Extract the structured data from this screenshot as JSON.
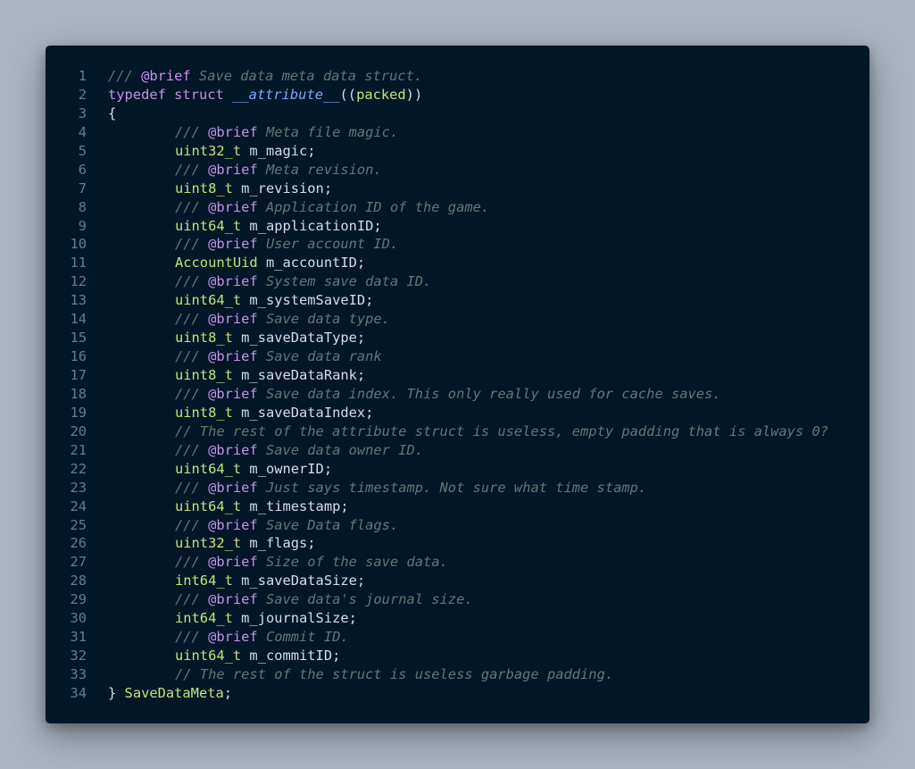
{
  "editor": {
    "colors": {
      "background": "#011627",
      "page_background": "#a8b4bf",
      "line_number": "#5f7e97",
      "comment": "#637777",
      "keyword": "#c792ea",
      "attribute": "#82aaff",
      "type": "#c5e478",
      "text": "#d6deeb"
    },
    "lines": [
      {
        "n": "1",
        "indent": 0,
        "tokens": [
          {
            "c": "comment",
            "t": "/// "
          },
          {
            "c": "tag",
            "t": "@brief"
          },
          {
            "c": "comment",
            "t": " Save data meta data struct."
          }
        ]
      },
      {
        "n": "2",
        "indent": 0,
        "tokens": [
          {
            "c": "keyword",
            "t": "typedef"
          },
          {
            "c": "text",
            "t": " "
          },
          {
            "c": "keyword",
            "t": "struct"
          },
          {
            "c": "text",
            "t": " "
          },
          {
            "c": "attr",
            "t": "__attribute__"
          },
          {
            "c": "punct",
            "t": "(("
          },
          {
            "c": "type",
            "t": "packed"
          },
          {
            "c": "punct",
            "t": "))"
          }
        ]
      },
      {
        "n": "3",
        "indent": 0,
        "tokens": [
          {
            "c": "punct",
            "t": "{"
          }
        ]
      },
      {
        "n": "4",
        "indent": 1,
        "tokens": [
          {
            "c": "comment",
            "t": "/// "
          },
          {
            "c": "tag",
            "t": "@brief"
          },
          {
            "c": "comment",
            "t": " Meta file magic."
          }
        ]
      },
      {
        "n": "5",
        "indent": 1,
        "tokens": [
          {
            "c": "type",
            "t": "uint32_t"
          },
          {
            "c": "text",
            "t": " "
          },
          {
            "c": "ident",
            "t": "m_magic"
          },
          {
            "c": "punct",
            "t": ";"
          }
        ]
      },
      {
        "n": "6",
        "indent": 1,
        "tokens": [
          {
            "c": "comment",
            "t": "/// "
          },
          {
            "c": "tag",
            "t": "@brief"
          },
          {
            "c": "comment",
            "t": " Meta revision."
          }
        ]
      },
      {
        "n": "7",
        "indent": 1,
        "tokens": [
          {
            "c": "type",
            "t": "uint8_t"
          },
          {
            "c": "text",
            "t": " "
          },
          {
            "c": "ident",
            "t": "m_revision"
          },
          {
            "c": "punct",
            "t": ";"
          }
        ]
      },
      {
        "n": "8",
        "indent": 1,
        "tokens": [
          {
            "c": "comment",
            "t": "/// "
          },
          {
            "c": "tag",
            "t": "@brief"
          },
          {
            "c": "comment",
            "t": " Application ID of the game."
          }
        ]
      },
      {
        "n": "9",
        "indent": 1,
        "tokens": [
          {
            "c": "type",
            "t": "uint64_t"
          },
          {
            "c": "text",
            "t": " "
          },
          {
            "c": "ident",
            "t": "m_applicationID"
          },
          {
            "c": "punct",
            "t": ";"
          }
        ]
      },
      {
        "n": "10",
        "indent": 1,
        "tokens": [
          {
            "c": "comment",
            "t": "/// "
          },
          {
            "c": "tag",
            "t": "@brief"
          },
          {
            "c": "comment",
            "t": " User account ID."
          }
        ]
      },
      {
        "n": "11",
        "indent": 1,
        "tokens": [
          {
            "c": "type",
            "t": "AccountUid"
          },
          {
            "c": "text",
            "t": " "
          },
          {
            "c": "ident",
            "t": "m_accountID"
          },
          {
            "c": "punct",
            "t": ";"
          }
        ]
      },
      {
        "n": "12",
        "indent": 1,
        "tokens": [
          {
            "c": "comment",
            "t": "/// "
          },
          {
            "c": "tag",
            "t": "@brief"
          },
          {
            "c": "comment",
            "t": " System save data ID."
          }
        ]
      },
      {
        "n": "13",
        "indent": 1,
        "tokens": [
          {
            "c": "type",
            "t": "uint64_t"
          },
          {
            "c": "text",
            "t": " "
          },
          {
            "c": "ident",
            "t": "m_systemSaveID"
          },
          {
            "c": "punct",
            "t": ";"
          }
        ]
      },
      {
        "n": "14",
        "indent": 1,
        "tokens": [
          {
            "c": "comment",
            "t": "/// "
          },
          {
            "c": "tag",
            "t": "@brief"
          },
          {
            "c": "comment",
            "t": " Save data type."
          }
        ]
      },
      {
        "n": "15",
        "indent": 1,
        "tokens": [
          {
            "c": "type",
            "t": "uint8_t"
          },
          {
            "c": "text",
            "t": " "
          },
          {
            "c": "ident",
            "t": "m_saveDataType"
          },
          {
            "c": "punct",
            "t": ";"
          }
        ]
      },
      {
        "n": "16",
        "indent": 1,
        "tokens": [
          {
            "c": "comment",
            "t": "/// "
          },
          {
            "c": "tag",
            "t": "@brief"
          },
          {
            "c": "comment",
            "t": " Save data rank"
          }
        ]
      },
      {
        "n": "17",
        "indent": 1,
        "tokens": [
          {
            "c": "type",
            "t": "uint8_t"
          },
          {
            "c": "text",
            "t": " "
          },
          {
            "c": "ident",
            "t": "m_saveDataRank"
          },
          {
            "c": "punct",
            "t": ";"
          }
        ]
      },
      {
        "n": "18",
        "indent": 1,
        "tokens": [
          {
            "c": "comment",
            "t": "/// "
          },
          {
            "c": "tag",
            "t": "@brief"
          },
          {
            "c": "comment",
            "t": " Save data index. This only really used for cache saves."
          }
        ]
      },
      {
        "n": "19",
        "indent": 1,
        "tokens": [
          {
            "c": "type",
            "t": "uint8_t"
          },
          {
            "c": "text",
            "t": " "
          },
          {
            "c": "ident",
            "t": "m_saveDataIndex"
          },
          {
            "c": "punct",
            "t": ";"
          }
        ]
      },
      {
        "n": "20",
        "indent": 1,
        "tokens": [
          {
            "c": "comment",
            "t": "// The rest of the attribute struct is useless, empty padding that is always 0?"
          }
        ]
      },
      {
        "n": "21",
        "indent": 1,
        "tokens": [
          {
            "c": "comment",
            "t": "/// "
          },
          {
            "c": "tag",
            "t": "@brief"
          },
          {
            "c": "comment",
            "t": " Save data owner ID."
          }
        ]
      },
      {
        "n": "22",
        "indent": 1,
        "tokens": [
          {
            "c": "type",
            "t": "uint64_t"
          },
          {
            "c": "text",
            "t": " "
          },
          {
            "c": "ident",
            "t": "m_ownerID"
          },
          {
            "c": "punct",
            "t": ";"
          }
        ]
      },
      {
        "n": "23",
        "indent": 1,
        "tokens": [
          {
            "c": "comment",
            "t": "/// "
          },
          {
            "c": "tag",
            "t": "@brief"
          },
          {
            "c": "comment",
            "t": " Just says timestamp. Not sure what time stamp."
          }
        ]
      },
      {
        "n": "24",
        "indent": 1,
        "tokens": [
          {
            "c": "type",
            "t": "uint64_t"
          },
          {
            "c": "text",
            "t": " "
          },
          {
            "c": "ident",
            "t": "m_timestamp"
          },
          {
            "c": "punct",
            "t": ";"
          }
        ]
      },
      {
        "n": "25",
        "indent": 1,
        "tokens": [
          {
            "c": "comment",
            "t": "/// "
          },
          {
            "c": "tag",
            "t": "@brief"
          },
          {
            "c": "comment",
            "t": " Save Data flags."
          }
        ]
      },
      {
        "n": "26",
        "indent": 1,
        "tokens": [
          {
            "c": "type",
            "t": "uint32_t"
          },
          {
            "c": "text",
            "t": " "
          },
          {
            "c": "ident",
            "t": "m_flags"
          },
          {
            "c": "punct",
            "t": ";"
          }
        ]
      },
      {
        "n": "27",
        "indent": 1,
        "tokens": [
          {
            "c": "comment",
            "t": "/// "
          },
          {
            "c": "tag",
            "t": "@brief"
          },
          {
            "c": "comment",
            "t": " Size of the save data."
          }
        ]
      },
      {
        "n": "28",
        "indent": 1,
        "tokens": [
          {
            "c": "type",
            "t": "int64_t"
          },
          {
            "c": "text",
            "t": " "
          },
          {
            "c": "ident",
            "t": "m_saveDataSize"
          },
          {
            "c": "punct",
            "t": ";"
          }
        ]
      },
      {
        "n": "29",
        "indent": 1,
        "tokens": [
          {
            "c": "comment",
            "t": "/// "
          },
          {
            "c": "tag",
            "t": "@brief"
          },
          {
            "c": "comment",
            "t": " Save data's journal size."
          }
        ]
      },
      {
        "n": "30",
        "indent": 1,
        "tokens": [
          {
            "c": "type",
            "t": "int64_t"
          },
          {
            "c": "text",
            "t": " "
          },
          {
            "c": "ident",
            "t": "m_journalSize"
          },
          {
            "c": "punct",
            "t": ";"
          }
        ]
      },
      {
        "n": "31",
        "indent": 1,
        "tokens": [
          {
            "c": "comment",
            "t": "/// "
          },
          {
            "c": "tag",
            "t": "@brief"
          },
          {
            "c": "comment",
            "t": " Commit ID."
          }
        ]
      },
      {
        "n": "32",
        "indent": 1,
        "tokens": [
          {
            "c": "type",
            "t": "uint64_t"
          },
          {
            "c": "text",
            "t": " "
          },
          {
            "c": "ident",
            "t": "m_commitID"
          },
          {
            "c": "punct",
            "t": ";"
          }
        ]
      },
      {
        "n": "33",
        "indent": 1,
        "tokens": [
          {
            "c": "comment",
            "t": "// The rest of the struct is useless garbage padding."
          }
        ]
      },
      {
        "n": "34",
        "indent": 0,
        "tokens": [
          {
            "c": "punct",
            "t": "} "
          },
          {
            "c": "type",
            "t": "SaveDataMeta"
          },
          {
            "c": "punct",
            "t": ";"
          }
        ]
      }
    ]
  }
}
